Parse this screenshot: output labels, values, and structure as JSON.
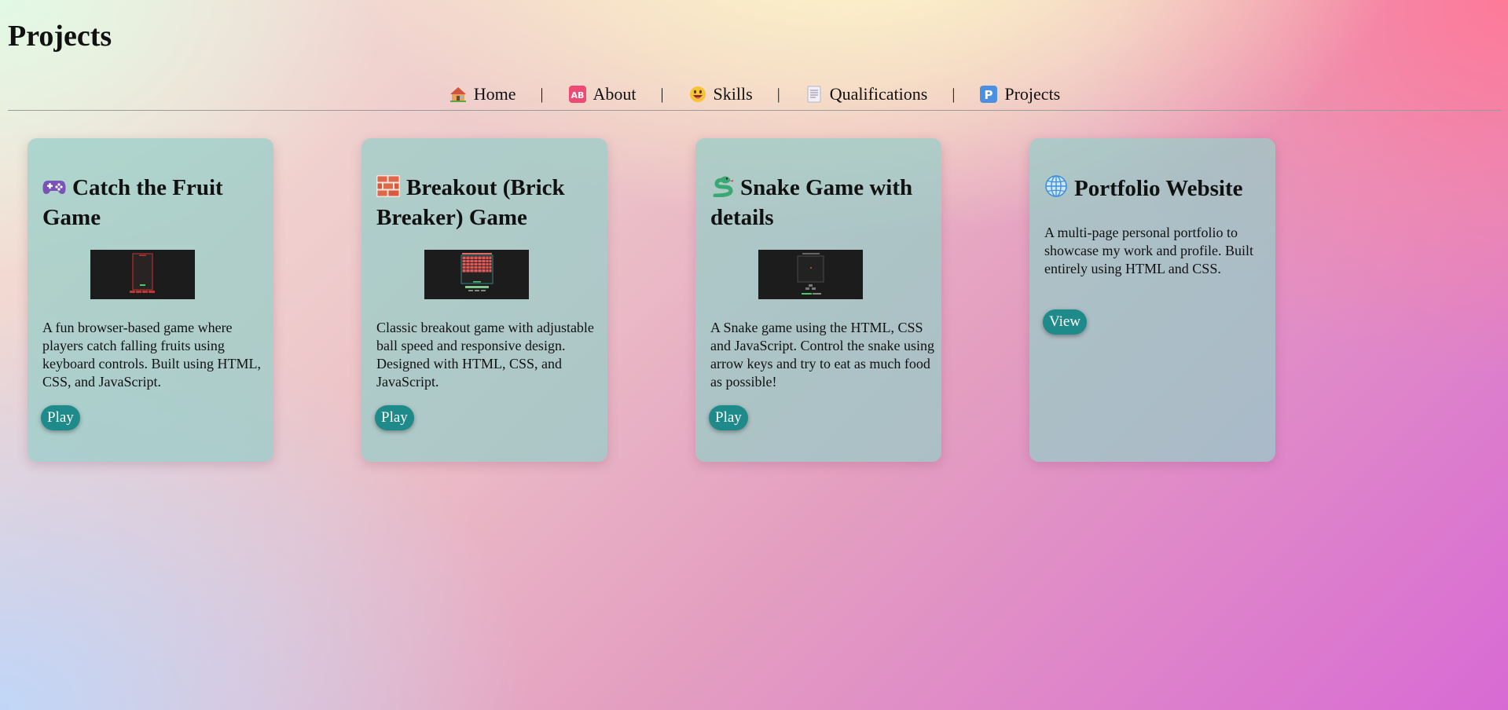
{
  "page": {
    "title": "Projects"
  },
  "nav": {
    "items": [
      {
        "label": "Home",
        "icon": "house-icon"
      },
      {
        "label": "About",
        "icon": "ab-badge-icon"
      },
      {
        "label": "Skills",
        "icon": "smiley-icon"
      },
      {
        "label": "Qualifications",
        "icon": "document-icon"
      },
      {
        "label": "Projects",
        "icon": "p-badge-icon"
      }
    ],
    "separator": "|"
  },
  "projects": [
    {
      "title": "Catch the Fruit Game",
      "icon": "game-controller-icon",
      "description": "A fun browser-based game where players catch falling fruits using keyboard controls. Built using HTML, CSS, and JavaScript.",
      "button": "Play"
    },
    {
      "title": "Breakout (Brick Breaker) Game",
      "icon": "brick-icon",
      "description": "Classic breakout game with adjustable ball speed and responsive design. Designed with HTML, CSS, and JavaScript.",
      "button": "Play"
    },
    {
      "title": "Snake Game with details",
      "icon": "snake-icon",
      "description": "A Snake game using the HTML, CSS and JavaScript. Control the snake using arrow keys and try to eat as much food as possible!",
      "button": "Play"
    },
    {
      "title": "Portfolio Website",
      "icon": "globe-icon",
      "description": "A multi-page personal portfolio to showcase my work and profile. Built entirely using HTML and CSS.",
      "button": "View"
    }
  ],
  "colors": {
    "button_bg": "#1f8a8a",
    "card_bg": "#96cdc8"
  }
}
